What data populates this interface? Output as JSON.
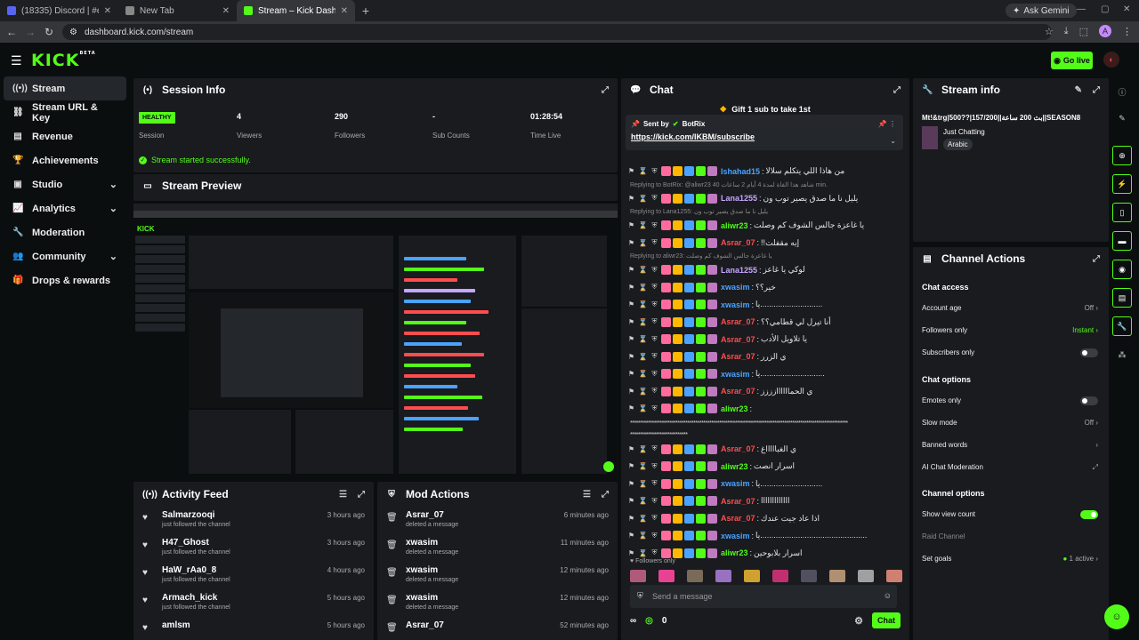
{
  "browser": {
    "tabs": [
      {
        "title": "(18335) Discord | #emotes | iKB",
        "color": "#5865f2"
      },
      {
        "title": "New Tab",
        "color": "#888888"
      },
      {
        "title": "Stream – Kick Dashboard",
        "color": "#53fc18"
      }
    ],
    "new_tab": "+",
    "ask_gemini": "Ask Gemini",
    "url": "dashboard.kick.com/stream",
    "profile_initial": "A"
  },
  "header": {
    "logo": "KICK",
    "logo_beta": "BETA",
    "go_live": "Go live"
  },
  "sidebar": {
    "items": [
      {
        "label": "Stream",
        "icon": "broadcast-icon"
      },
      {
        "label": "Stream URL & Key",
        "icon": "link-icon"
      },
      {
        "label": "Revenue",
        "icon": "revenue-icon"
      },
      {
        "label": "Achievements",
        "icon": "trophy-icon"
      },
      {
        "label": "Studio",
        "icon": "studio-icon"
      },
      {
        "label": "Analytics",
        "icon": "analytics-icon"
      },
      {
        "label": "Moderation",
        "icon": "wrench-icon"
      },
      {
        "label": "Community",
        "icon": "community-icon"
      },
      {
        "label": "Drops & rewards",
        "icon": "gift-icon"
      }
    ]
  },
  "session": {
    "title": "Session Info",
    "health": "HEALTHY",
    "health_label": "Session",
    "stats": [
      {
        "value": "4",
        "label": "Viewers"
      },
      {
        "value": "290",
        "label": "Followers"
      },
      {
        "value": "-",
        "label": "Sub Counts"
      },
      {
        "value": "01:28:54",
        "label": "Time Live"
      }
    ],
    "status": "Stream started successfully."
  },
  "preview": {
    "title": "Stream Preview"
  },
  "activity": {
    "title": "Activity Feed",
    "items": [
      {
        "name": "Salmarzooqi",
        "sub": "just followed the channel",
        "time": "3 hours ago"
      },
      {
        "name": "H47_Ghost",
        "sub": "just followed the channel",
        "time": "3 hours ago"
      },
      {
        "name": "HaW_rAa0_8",
        "sub": "just followed the channel",
        "time": "4 hours ago"
      },
      {
        "name": "Armach_kick",
        "sub": "just followed the channel",
        "time": "5 hours ago"
      },
      {
        "name": "amlsm",
        "sub": "",
        "time": "5 hours ago"
      }
    ]
  },
  "modactions": {
    "title": "Mod Actions",
    "items": [
      {
        "name": "Asrar_07",
        "sub": "deleted a message",
        "time": "6 minutes ago"
      },
      {
        "name": "xwasim",
        "sub": "deleted a message",
        "time": "11 minutes ago"
      },
      {
        "name": "xwasim",
        "sub": "deleted a message",
        "time": "12 minutes ago"
      },
      {
        "name": "xwasim",
        "sub": "deleted a message",
        "time": "12 minutes ago"
      },
      {
        "name": "Asrar_07",
        "sub": "",
        "time": "52 minutes ago"
      }
    ]
  },
  "chat": {
    "title": "Chat",
    "gift": "Gift 1 sub to take 1st",
    "pinned": {
      "sent_by": "Sent by",
      "user": "BotRix",
      "link": "https://kick.com/IKBM/subscribe"
    },
    "messages": [
      {
        "user": "Ishahad15",
        "color": "#4aa3ff",
        "text": "من هاذا اللي يتكلم سلالا"
      },
      {
        "reply": "Replying to BotRix: @aliwr23 40 شاهد هذا الفاة لمدة 4 أيام 2 ساعات min."
      },
      {
        "user": "Lana1255",
        "color": "#c7a6ff",
        "text": "يليل نا ما صدق يصير توب ون"
      },
      {
        "reply": "Replying to Lana1255: يليل نا ما صدق يصير توب ون"
      },
      {
        "user": "aliwr23",
        "color": "#53fc18",
        "text": "يا غاعزة جالس الشوف كم وصلت"
      },
      {
        "user": "Asrar_07",
        "color": "#ff4d4d",
        "text": "!!إيه مقفلت"
      },
      {
        "reply": "Replying to aliwr23: يا غاعزة جالس الشوف كم وصلت"
      },
      {
        "user": "Lana1255",
        "color": "#c7a6ff",
        "text": "لوكي يا غاعز"
      },
      {
        "user": "xwasim",
        "color": "#4aa3ff",
        "text": "خير؟؟"
      },
      {
        "user": "xwasim",
        "color": "#4aa3ff",
        "text": "يا............................"
      },
      {
        "user": "Asrar_07",
        "color": "#ff4d4d",
        "text": "أنا تيرل لي قطامي؟؟"
      },
      {
        "user": "Asrar_07",
        "color": "#ff4d4d",
        "text": "يا تلاويل الأدب"
      },
      {
        "user": "Asrar_07",
        "color": "#ff4d4d",
        "text": "ي الزرر"
      },
      {
        "user": "xwasim",
        "color": "#4aa3ff",
        "text": "يا............................."
      },
      {
        "user": "Asrar_07",
        "color": "#ff4d4d",
        "text": "ي الحماااااازززز"
      },
      {
        "user": "aliwr23",
        "color": "#53fc18",
        "text": ""
      },
      {
        "long": "**************************************************************************************************************"
      },
      {
        "long": "*****************************"
      },
      {
        "user": "Asrar_07",
        "color": "#ff4d4d",
        "text": "ي الغباااااغ"
      },
      {
        "user": "aliwr23",
        "color": "#53fc18",
        "text": "اسرار انصت"
      },
      {
        "user": "xwasim",
        "color": "#4aa3ff",
        "text": "يا............................"
      },
      {
        "user": "Asrar_07",
        "color": "#ff4d4d",
        "text": "ااااااااااااا"
      },
      {
        "user": "Asrar_07",
        "color": "#ff4d4d",
        "text": "اذا عاد جيت عندك"
      },
      {
        "user": "xwasim",
        "color": "#4aa3ff",
        "text": "يا................................................"
      },
      {
        "user": "aliwr23",
        "color": "#53fc18",
        "text": "اسرار بلابوحين"
      }
    ],
    "followers_only": "Followers only",
    "placeholder": "Send a message",
    "count": "0",
    "send": "Chat"
  },
  "streaminfo": {
    "title": "Stream info",
    "stream_title": "Mt!&trg|500??|157/200||بث 200 ساعة||SEASON8",
    "category": "Just Chatting",
    "language": "Arabic"
  },
  "channelactions": {
    "title": "Channel Actions",
    "chat_access": "Chat access",
    "account_age": "Account age",
    "account_age_val": "Off",
    "followers_only": "Followers only",
    "followers_only_val": "Instant",
    "subscribers_only": "Subscribers only",
    "chat_options": "Chat options",
    "emotes_only": "Emotes only",
    "slow_mode": "Slow mode",
    "slow_mode_val": "Off",
    "banned_words": "Banned words",
    "ai_mod": "AI Chat Moderation",
    "channel_options": "Channel options",
    "show_view_count": "Show view count",
    "raid_channel": "Raid Channel",
    "set_goals": "Set goals",
    "set_goals_val": "1 active"
  }
}
